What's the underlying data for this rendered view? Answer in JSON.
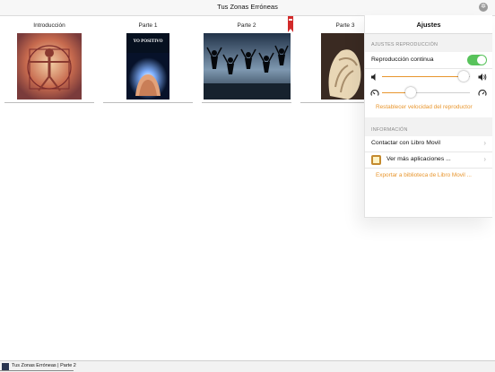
{
  "window": {
    "title": "Tus Zonas Erróneas"
  },
  "shelf": {
    "books": [
      {
        "label": "Introducción"
      },
      {
        "label": "Parte 1",
        "cover_text": "YO POSITIVO"
      },
      {
        "label": "Parte 2"
      },
      {
        "label": "Parte 3"
      }
    ]
  },
  "settings": {
    "title": "Ajustes",
    "playback_section": "AJUSTES REPRODUCCIÓN",
    "continuous_label": "Reproducción continua",
    "continuous_on": true,
    "volume_level": 0.93,
    "speed_level": 0.33,
    "reset_speed": "Restablecer velocidad del reproductor",
    "info_section": "INFORMACIÓN",
    "contact": "Contactar con Libro Movil",
    "more_apps": "Ver más aplicaciones ...",
    "export": "Exportar a biblioteca de Libro Movil ..."
  },
  "now_playing": {
    "text": "Tus Zonas Erróneas | Parte 2"
  },
  "colors": {
    "accent": "#e8962e",
    "toggle": "#58c35b",
    "bookmark": "#d22a2a"
  },
  "icons": {
    "settings": "gear-icon",
    "volume_low": "speaker-low-icon",
    "volume_high": "speaker-high-icon",
    "speed_slow": "speed-slow-icon",
    "speed_fast": "speed-fast-icon",
    "chevron": "chevron-right-icon",
    "bookmark": "bookmark-icon"
  }
}
